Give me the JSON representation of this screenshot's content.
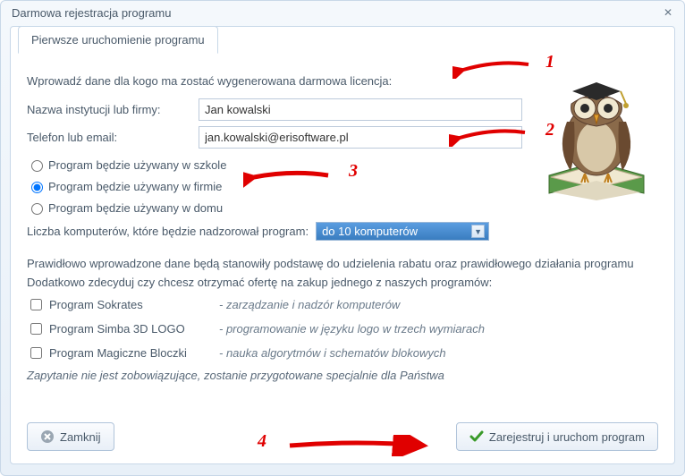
{
  "window": {
    "title": "Darmowa rejestracja programu"
  },
  "tab": {
    "label": "Pierwsze uruchomienie programu"
  },
  "form": {
    "intro": "Wprowadź dane dla kogo ma zostać wygenerowana darmowa licencja:",
    "name_label": "Nazwa instytucji lub firmy:",
    "name_value": "Jan kowalski",
    "contact_label": "Telefon lub email:",
    "contact_value": "jan.kowalski@erisoftware.pl",
    "radio": {
      "school": "Program będzie używany w szkole",
      "company": "Program będzie używany w firmie",
      "home": "Program będzie używany w domu",
      "selected": "company"
    },
    "computers_label": "Liczba komputerów, które będzie nadzorował program:",
    "computers_value": "do 10 komputerów"
  },
  "info": {
    "line1": "Prawidłowo wprowadzone dane będą stanowiły podstawę do udzielenia rabatu oraz prawidłowego działania programu",
    "line2": "Dodatkowo zdecyduj czy chcesz otrzymać ofertę na zakup jednego z naszych programów:",
    "programs": [
      {
        "name": "Program Sokrates",
        "desc": "- zarządzanie i nadzór komputerów"
      },
      {
        "name": "Program Simba 3D LOGO",
        "desc": "- programowanie w języku logo w trzech wymiarach"
      },
      {
        "name": "Program Magiczne Bloczki",
        "desc": "- nauka algorytmów i schematów blokowych"
      }
    ],
    "disclaimer": "Zapytanie nie jest zobowiązujące, zostanie przygotowane specjalnie dla Państwa"
  },
  "buttons": {
    "close": "Zamknij",
    "register": "Zarejestruj i uruchom program"
  },
  "annotations": {
    "n1": "1",
    "n2": "2",
    "n3": "3",
    "n4": "4"
  }
}
